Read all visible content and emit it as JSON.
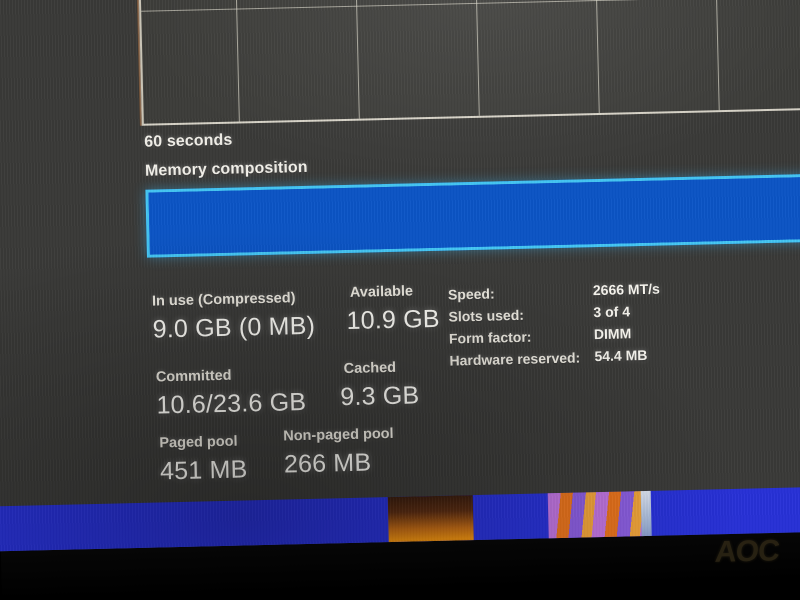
{
  "device": {
    "monitor_brand": "AOC"
  },
  "graph": {
    "time_axis_label": "60 seconds",
    "vertical_gridlines": 6,
    "horizontal_gridlines": 1
  },
  "composition": {
    "section_label": "Memory composition",
    "bar_color": "#0b55c6",
    "bar_border_color": "#44c6f4",
    "segments": [
      {
        "name": "in-use",
        "percent": 100,
        "color": "#0b55c6"
      }
    ]
  },
  "stats": [
    {
      "label": "In use (Compressed)",
      "value": "9.0 GB (0 MB)"
    },
    {
      "label": "Available",
      "value": "10.9 GB"
    },
    {
      "label": "Committed",
      "value": "10.6/23.6 GB"
    },
    {
      "label": "Cached",
      "value": "9.3 GB"
    },
    {
      "label": "Paged pool",
      "value": "451 MB"
    },
    {
      "label": "Non-paged pool",
      "value": "266 MB"
    }
  ],
  "specs": [
    {
      "key": "Speed:",
      "value": "2666 MT/s"
    },
    {
      "key": "Slots used:",
      "value": "3 of 4"
    },
    {
      "key": "Form factor:",
      "value": "DIMM"
    },
    {
      "key": "Hardware reserved:",
      "value": "54.4 MB"
    }
  ],
  "colors": {
    "panel_background": "#3a3a38",
    "text_primary": "#f3f1ea",
    "desktop_blue": "#2731d8",
    "bezel_black": "#060606"
  }
}
